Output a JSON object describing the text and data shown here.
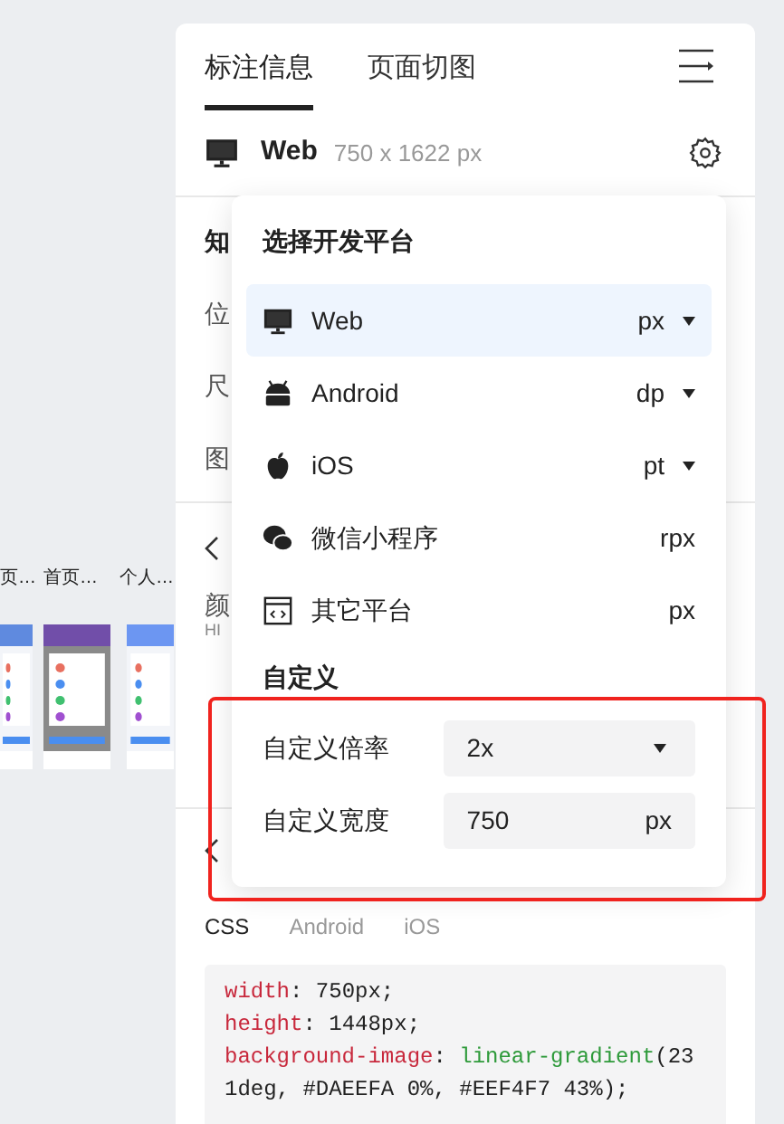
{
  "thumbnails": [
    {
      "label": "页…"
    },
    {
      "label": "首页…"
    },
    {
      "label": "个人…"
    }
  ],
  "panel_tabs": [
    {
      "label": "标注信息",
      "selected": true
    },
    {
      "label": "页面切图",
      "selected": false
    }
  ],
  "artboard": {
    "platform": "Web",
    "size": "750 x 1622 px"
  },
  "info_section": [
    "知",
    "位",
    "尺",
    "图"
  ],
  "color_section": {
    "label": "颜",
    "sub": "HI"
  },
  "code_tabs": [
    {
      "label": "CSS",
      "selected": true
    },
    {
      "label": "Android",
      "selected": false
    },
    {
      "label": "iOS",
      "selected": false
    }
  ],
  "code": [
    [
      {
        "kind": "prop",
        "text": "width"
      },
      {
        "kind": "plain",
        "text": ": 750px;"
      }
    ],
    [
      {
        "kind": "prop",
        "text": "height"
      },
      {
        "kind": "plain",
        "text": ": 1448px;"
      }
    ],
    [
      {
        "kind": "prop",
        "text": "background-image"
      },
      {
        "kind": "plain",
        "text": ": "
      },
      {
        "kind": "func",
        "text": "linear-gradient"
      },
      {
        "kind": "plain",
        "text": "(23"
      }
    ],
    [
      {
        "kind": "plain",
        "text": "1deg, #DAEEFA 0%, #EEF4F7 43%);"
      }
    ]
  ],
  "platform_popup": {
    "title": "选择开发平台",
    "platforms": [
      {
        "kind": "web",
        "name": "Web",
        "unit": "px",
        "dropdown": true,
        "selected": true
      },
      {
        "kind": "android",
        "name": "Android",
        "unit": "dp",
        "dropdown": true,
        "selected": false
      },
      {
        "kind": "ios",
        "name": "iOS",
        "unit": "pt",
        "dropdown": true,
        "selected": false
      },
      {
        "kind": "wechat",
        "name": "微信小程序",
        "unit": "rpx",
        "dropdown": false,
        "selected": false
      },
      {
        "kind": "other",
        "name": "其它平台",
        "unit": "px",
        "dropdown": false,
        "selected": false
      }
    ],
    "custom_heading": "自定义",
    "scale": {
      "label": "自定义倍率",
      "value": "2x"
    },
    "width": {
      "label": "自定义宽度",
      "value": "750",
      "unit": "px"
    }
  }
}
